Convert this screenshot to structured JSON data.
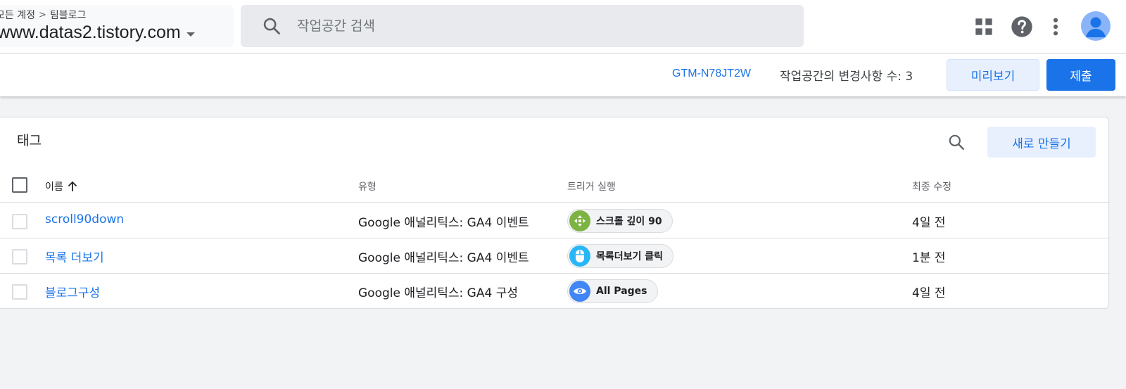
{
  "header": {
    "breadcrumb": [
      "모든 계정",
      "팀블로그"
    ],
    "container_name": "www.datas2.tistory.com",
    "search": {
      "placeholder": "작업공간 검색",
      "value": ""
    }
  },
  "subbar": {
    "container_id": "GTM-N78JT2W",
    "changes_label": "작업공간의 변경사항 수: 3",
    "preview_label": "미리보기",
    "submit_label": "제출"
  },
  "tags": {
    "title": "태그",
    "new_label": "새로 만들기",
    "columns": {
      "name": "이름",
      "type": "유형",
      "trigger": "트리거 실행",
      "modified": "최종 수정"
    },
    "rows": [
      {
        "name": "scroll90down",
        "type": "Google 애널리틱스: GA4 이벤트",
        "trigger": "스크롤 깊이 90",
        "trigger_icon": "scroll-depth-icon",
        "trigger_color": "#7cb342",
        "modified": "4일 전"
      },
      {
        "name": "목록 더보기",
        "type": "Google 애널리틱스: GA4 이벤트",
        "trigger": "목록더보기 클릭",
        "trigger_icon": "click-mouse-icon",
        "trigger_color": "#29b6f6",
        "modified": "1분 전"
      },
      {
        "name": "블로그구성",
        "type": "Google 애널리틱스: GA4 구성",
        "trigger": "All Pages",
        "trigger_icon": "pageview-eye-icon",
        "trigger_color": "#4285f4",
        "modified": "4일 전"
      }
    ]
  },
  "colors": {
    "accent": "#1a73e8",
    "background": "#f1f3f4"
  }
}
